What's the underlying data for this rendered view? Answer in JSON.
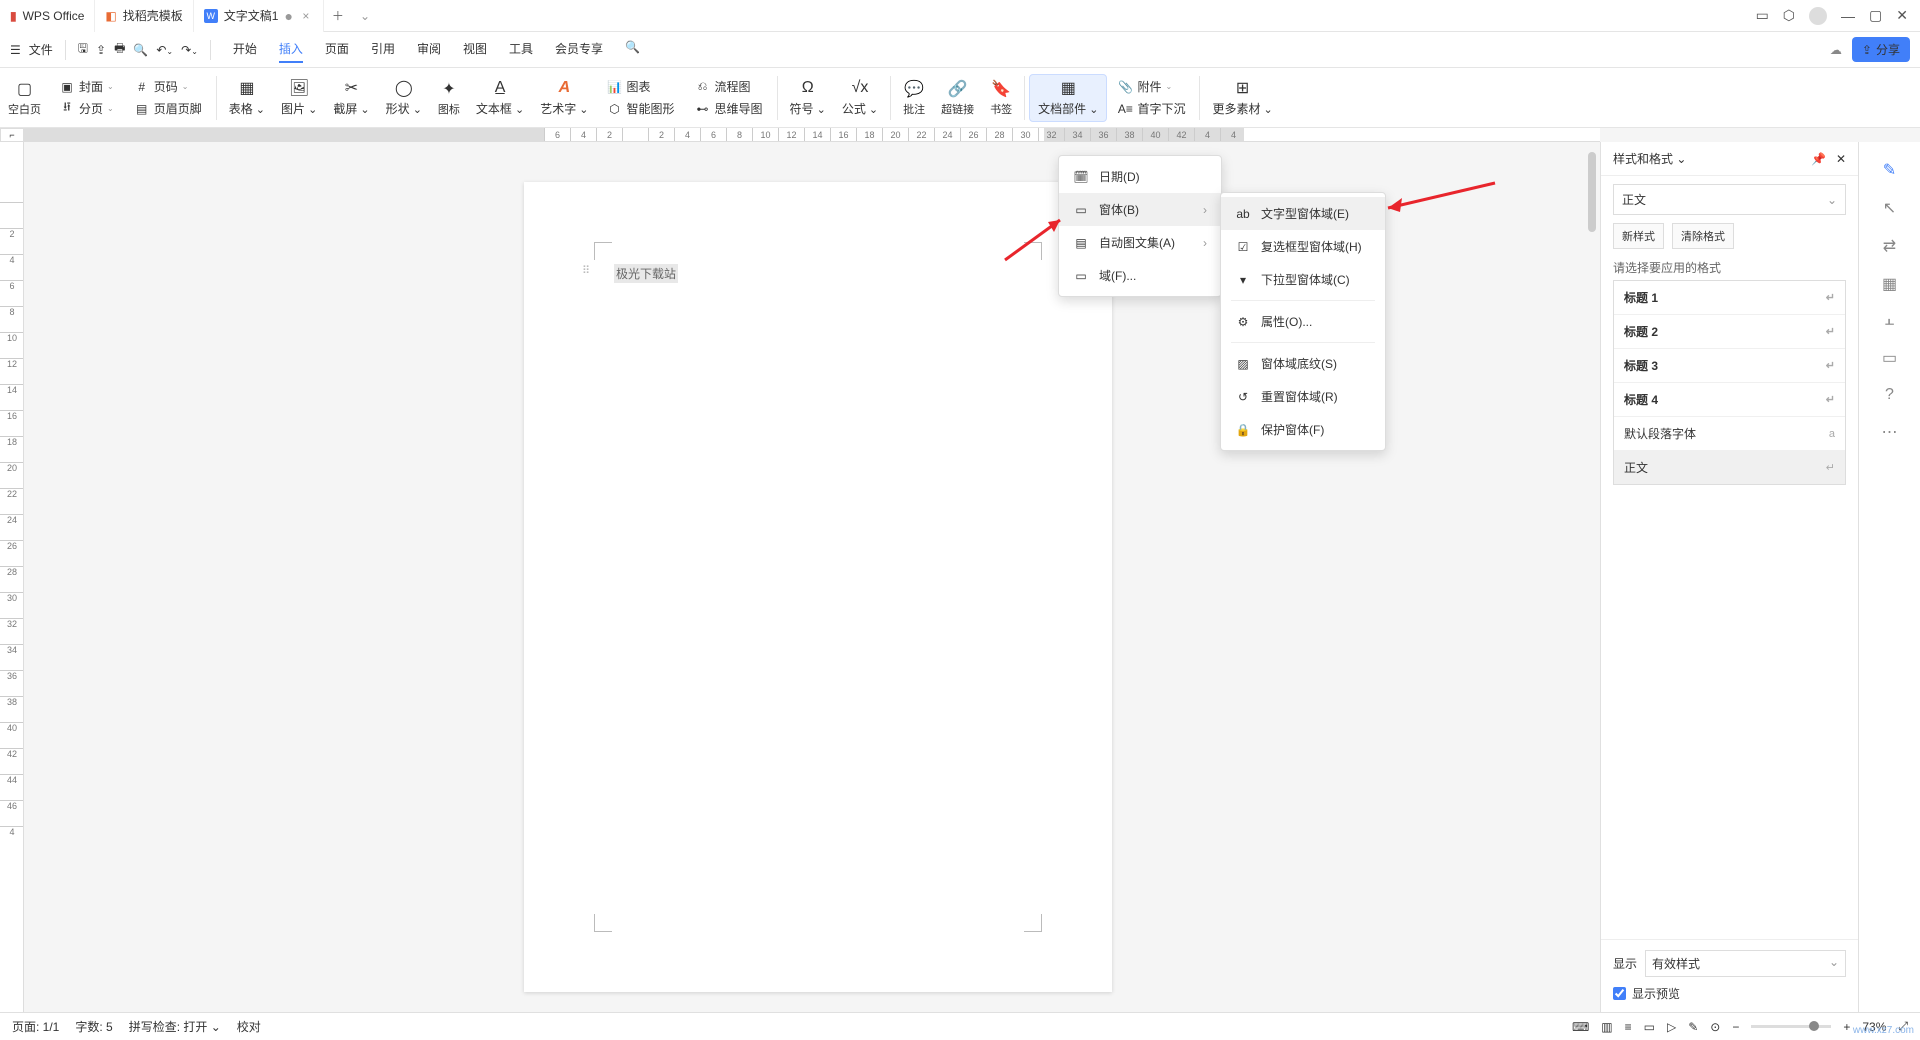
{
  "title": {
    "wps": "WPS Office",
    "template": "找稻壳模板",
    "doc": "文字文稿1"
  },
  "quick": {
    "file": "文件"
  },
  "menuTabs": {
    "start": "开始",
    "insert": "插入",
    "page": "页面",
    "ref": "引用",
    "review": "审阅",
    "view": "视图",
    "tools": "工具",
    "vip": "会员专享"
  },
  "share": "分享",
  "ribbon": {
    "blank": "空白页",
    "cover": "封面",
    "pageno": "页码",
    "section": "分页",
    "header": "页眉页脚",
    "table": "表格",
    "pic": "图片",
    "screenshot": "截屏",
    "shape": "形状",
    "icon": "图标",
    "textbox": "文本框",
    "wordart": "艺术字",
    "charts": "图表",
    "smartart": "智能图形",
    "flowchart": "流程图",
    "mindmap": "思维导图",
    "symbol": "符号",
    "formula": "公式",
    "comment": "批注",
    "hyperlink": "超链接",
    "bookmark": "书签",
    "docparts": "文档部件",
    "attach": "附件",
    "dropcap": "首字下沉",
    "more": "更多素材"
  },
  "dropdown1": {
    "date": "日期(D)",
    "form": "窗体(B)",
    "autotext": "自动图文集(A)",
    "field": "域(F)..."
  },
  "dropdown2": {
    "textfield": "文字型窗体域(E)",
    "checkbox": "复选框型窗体域(H)",
    "dropdown": "下拉型窗体域(C)",
    "props": "属性(O)...",
    "shade": "窗体域底纹(S)",
    "reset": "重置窗体域(R)",
    "protect": "保护窗体(F)"
  },
  "doc_text": "极光下载站",
  "ruler_h": [
    "6",
    "4",
    "2",
    "",
    "2",
    "4",
    "6",
    "8",
    "10",
    "12",
    "14",
    "16",
    "18",
    "20",
    "22",
    "24",
    "26",
    "28",
    "30",
    "32",
    "34",
    "36",
    "38",
    "40",
    "42",
    "4",
    "4"
  ],
  "ruler_v": [
    "",
    "2",
    "4",
    "6",
    "8",
    "10",
    "12",
    "14",
    "16",
    "18",
    "20",
    "22",
    "24",
    "26",
    "28",
    "30",
    "32",
    "34",
    "36",
    "38",
    "40",
    "42",
    "44",
    "46",
    "4"
  ],
  "styles": {
    "title": "样式和格式",
    "current": "正文",
    "newstyle": "新样式",
    "clear": "清除格式",
    "prompt": "请选择要应用的格式",
    "h1": "标题 1",
    "h2": "标题 2",
    "h3": "标题 3",
    "h4": "标题 4",
    "default": "默认段落字体",
    "body": "正文",
    "show": "显示",
    "show_val": "有效样式",
    "preview": "显示预览"
  },
  "status": {
    "page": "页面: 1/1",
    "words": "字数: 5",
    "spell": "拼写检查: 打开",
    "proof": "校对",
    "zoom": "73%"
  },
  "watermark": "www.xz7.com"
}
